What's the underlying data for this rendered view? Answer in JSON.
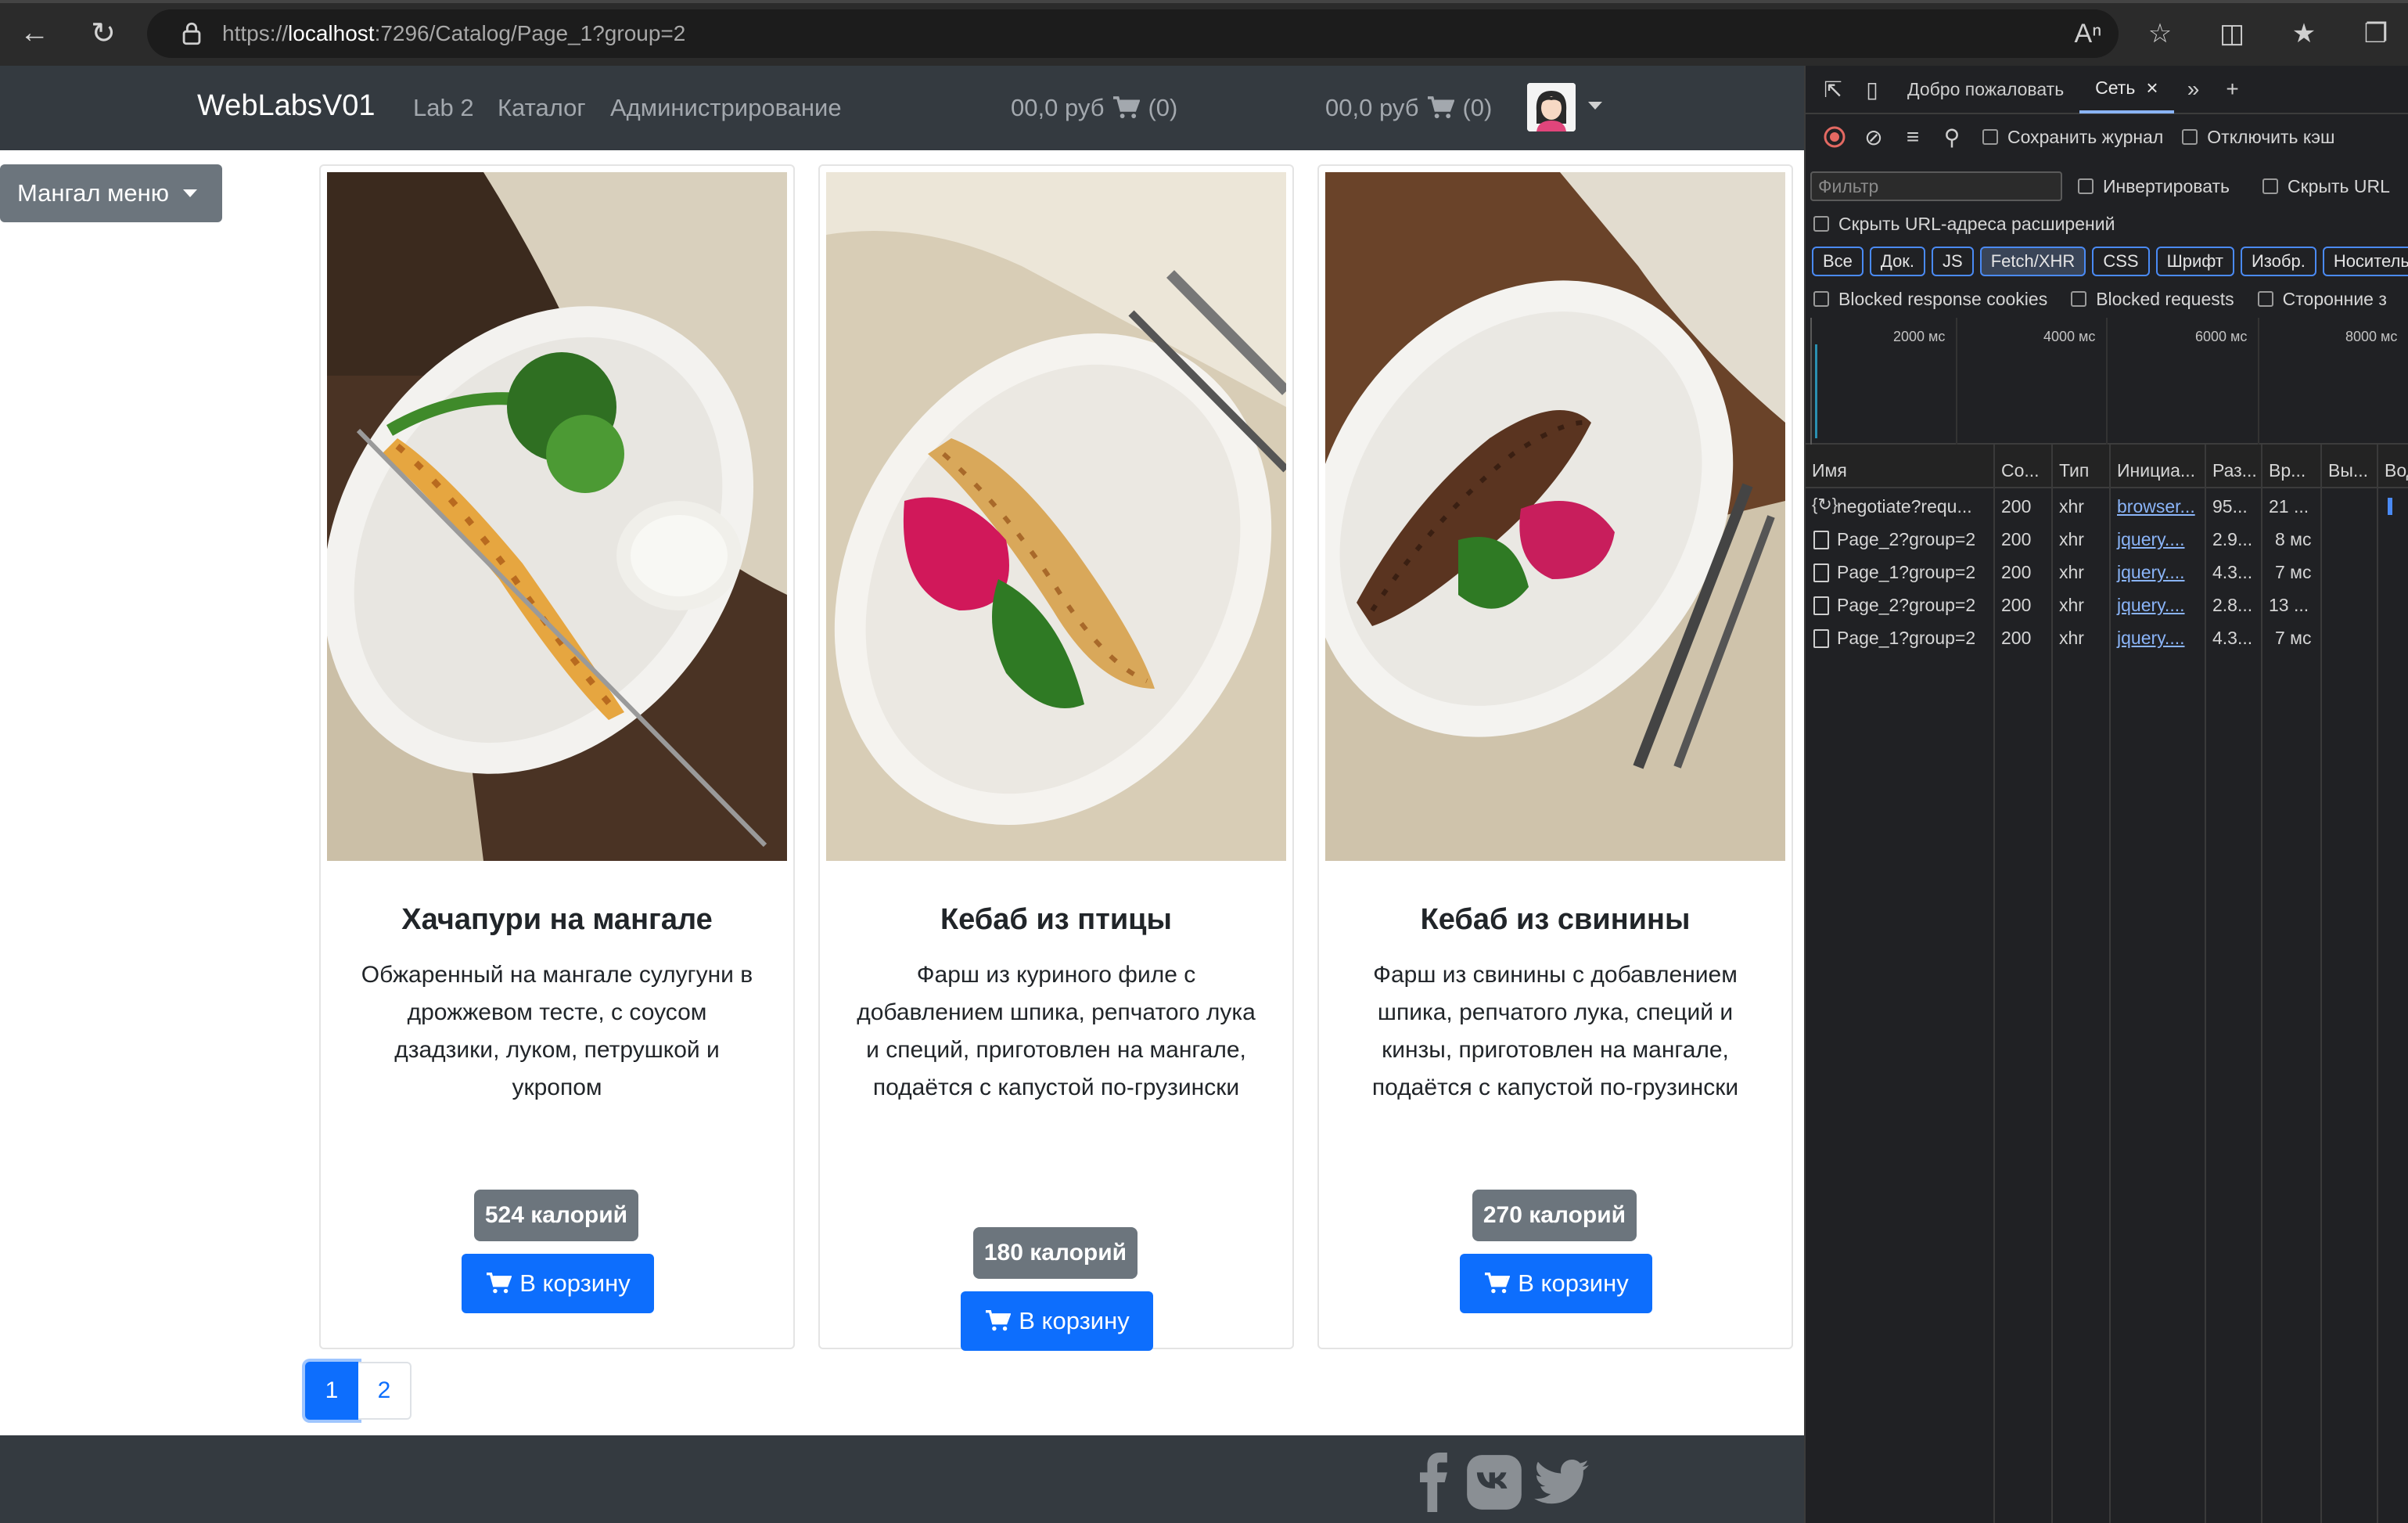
{
  "browser": {
    "url_prefix": "https://",
    "url_host": "localhost",
    "url_rest": ":7296/Catalog/Page_1?group=2"
  },
  "site": {
    "brand": "WebLabsV01",
    "nav": [
      "Lab 2",
      "Каталог",
      "Администрирование"
    ],
    "cart1": "00,0 руб",
    "cart1_count": "(0)",
    "cart2": "00,0 руб",
    "cart2_count": "(0)",
    "side_menu": "Мангал меню"
  },
  "products": [
    {
      "title": "Хачапури на мангале",
      "description": "Обжаренный на мангале сулугуни в дрожжевом тесте, с соусом дзадзики, луком, петрушкой и укропом",
      "calories": "524 калорий",
      "button": "В корзину",
      "image": "khachapuri-photo"
    },
    {
      "title": "Кебаб из птицы",
      "description": "Фарш из куриного филе с добавлением шпика, репчатого лука и специй, приготовлен на мангале, подаётся с капустой по-грузински",
      "calories": "180 калорий",
      "button": "В корзину",
      "image": "chicken-kebab-photo"
    },
    {
      "title": "Кебаб из свинины",
      "description": "Фарш из свинины с добавлением шпика, репчатого лука, специй и кинзы, приготовлен на мангале, подаётся с капустой по-грузински",
      "calories": "270 калорий",
      "button": "В корзину",
      "image": "pork-kebab-photo"
    }
  ],
  "pagination": [
    "1",
    "2"
  ],
  "devtools": {
    "tab_welcome": "Добро пожаловать",
    "tab_network": "Сеть",
    "preserve_log": "Сохранить журнал",
    "disable_cache": "Отключить кэш",
    "filter_placeholder": "Фильтр",
    "invert": "Инвертировать",
    "hide_url": "Скрыть URL",
    "hide_ext": "Скрыть URL-адреса расширений",
    "type_filters": [
      "Все",
      "Док.",
      "JS",
      "Fetch/XHR",
      "CSS",
      "Шрифт",
      "Изобр.",
      "Носитель"
    ],
    "blocked_cookies": "Blocked response cookies",
    "blocked_requests": "Blocked requests",
    "third_party": "Сторонние з",
    "ticks": [
      "2000 мс",
      "4000 мс",
      "6000 мс",
      "8000 мс"
    ],
    "columns": [
      "Имя",
      "Co...",
      "Тип",
      "Инициа...",
      "Раз...",
      "Вр...",
      "Вы...",
      "Вод"
    ],
    "rows": [
      {
        "name": "negotiate?requ...",
        "status": "200",
        "type": "xhr",
        "initiator": "browser...",
        "size": "95...",
        "time": "21 ..."
      },
      {
        "name": "Page_2?group=2",
        "status": "200",
        "type": "xhr",
        "initiator": "jquery....",
        "size": "2.9...",
        "time": "8 мс"
      },
      {
        "name": "Page_1?group=2",
        "status": "200",
        "type": "xhr",
        "initiator": "jquery....",
        "size": "4.3...",
        "time": "7 мс"
      },
      {
        "name": "Page_2?group=2",
        "status": "200",
        "type": "xhr",
        "initiator": "jquery....",
        "size": "2.8...",
        "time": "13 ..."
      },
      {
        "name": "Page_1?group=2",
        "status": "200",
        "type": "xhr",
        "initiator": "jquery....",
        "size": "4.3...",
        "time": "7 мс"
      }
    ]
  },
  "colors": {
    "primary": "#0d6efd",
    "navbar": "#343a40",
    "badge": "#6c757d"
  }
}
